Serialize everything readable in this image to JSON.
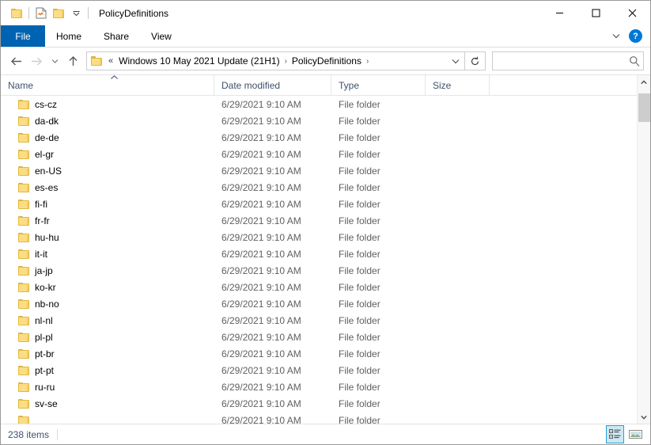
{
  "window": {
    "title": "PolicyDefinitions",
    "quick_access": [
      {
        "icon": "folder-icon",
        "name": "explorer-app-icon"
      },
      {
        "icon": "properties-icon",
        "name": "qat-properties"
      },
      {
        "icon": "new-folder-icon",
        "name": "qat-new-folder"
      },
      {
        "icon": "chevron-down-icon",
        "name": "qat-customize"
      }
    ],
    "controls": {
      "minimize": "—",
      "maximize": "☐",
      "close": "✕"
    }
  },
  "ribbon": {
    "tabs": [
      {
        "label": "File",
        "active": true
      },
      {
        "label": "Home",
        "active": false
      },
      {
        "label": "Share",
        "active": false
      },
      {
        "label": "View",
        "active": false
      }
    ],
    "expand_icon": "chevron-down-icon",
    "help_label": "?"
  },
  "address": {
    "back_icon": "arrow-left-icon",
    "forward_icon": "arrow-right-icon",
    "recent_icon": "chevron-down-icon",
    "up_icon": "arrow-up-icon",
    "overflow": "«",
    "crumbs": [
      "Windows 10 May 2021 Update (21H1)",
      "PolicyDefinitions"
    ],
    "separator": "›",
    "dropdown_icon": "chevron-down-icon",
    "refresh_icon": "refresh-icon"
  },
  "search": {
    "value": "",
    "placeholder": "",
    "icon": "search-icon"
  },
  "columns": {
    "name": "Name",
    "date_modified": "Date modified",
    "type": "Type",
    "size": "Size",
    "sort_icon": "chevron-up-icon"
  },
  "files": [
    {
      "name": "cs-cz",
      "date": "6/29/2021 9:10 AM",
      "type": "File folder",
      "size": ""
    },
    {
      "name": "da-dk",
      "date": "6/29/2021 9:10 AM",
      "type": "File folder",
      "size": ""
    },
    {
      "name": "de-de",
      "date": "6/29/2021 9:10 AM",
      "type": "File folder",
      "size": ""
    },
    {
      "name": "el-gr",
      "date": "6/29/2021 9:10 AM",
      "type": "File folder",
      "size": ""
    },
    {
      "name": "en-US",
      "date": "6/29/2021 9:10 AM",
      "type": "File folder",
      "size": ""
    },
    {
      "name": "es-es",
      "date": "6/29/2021 9:10 AM",
      "type": "File folder",
      "size": ""
    },
    {
      "name": "fi-fi",
      "date": "6/29/2021 9:10 AM",
      "type": "File folder",
      "size": ""
    },
    {
      "name": "fr-fr",
      "date": "6/29/2021 9:10 AM",
      "type": "File folder",
      "size": ""
    },
    {
      "name": "hu-hu",
      "date": "6/29/2021 9:10 AM",
      "type": "File folder",
      "size": ""
    },
    {
      "name": "it-it",
      "date": "6/29/2021 9:10 AM",
      "type": "File folder",
      "size": ""
    },
    {
      "name": "ja-jp",
      "date": "6/29/2021 9:10 AM",
      "type": "File folder",
      "size": ""
    },
    {
      "name": "ko-kr",
      "date": "6/29/2021 9:10 AM",
      "type": "File folder",
      "size": ""
    },
    {
      "name": "nb-no",
      "date": "6/29/2021 9:10 AM",
      "type": "File folder",
      "size": ""
    },
    {
      "name": "nl-nl",
      "date": "6/29/2021 9:10 AM",
      "type": "File folder",
      "size": ""
    },
    {
      "name": "pl-pl",
      "date": "6/29/2021 9:10 AM",
      "type": "File folder",
      "size": ""
    },
    {
      "name": "pt-br",
      "date": "6/29/2021 9:10 AM",
      "type": "File folder",
      "size": ""
    },
    {
      "name": "pt-pt",
      "date": "6/29/2021 9:10 AM",
      "type": "File folder",
      "size": ""
    },
    {
      "name": "ru-ru",
      "date": "6/29/2021 9:10 AM",
      "type": "File folder",
      "size": ""
    },
    {
      "name": "sv-se",
      "date": "6/29/2021 9:10 AM",
      "type": "File folder",
      "size": ""
    },
    {
      "name": "",
      "date": "6/29/2021 9:10 AM",
      "type": "File folder",
      "size": ""
    }
  ],
  "status": {
    "item_count": "238 items",
    "views": [
      {
        "name": "details-view",
        "active": true
      },
      {
        "name": "large-icons-view",
        "active": false
      }
    ]
  },
  "colors": {
    "accent": "#0063b1",
    "folder": "#fcdd86",
    "header_text": "#41506b",
    "selection": "#cce8f4"
  }
}
